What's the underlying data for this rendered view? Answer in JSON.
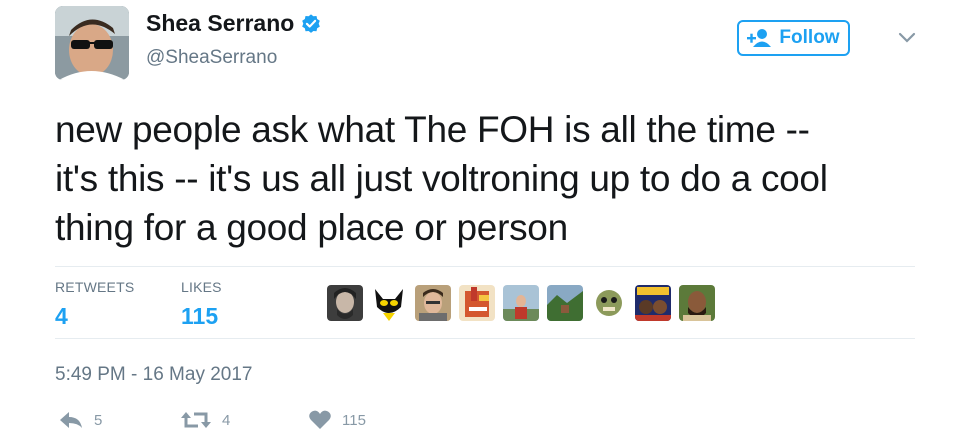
{
  "author": {
    "name": "Shea Serrano",
    "handle": "@SheaSerrano"
  },
  "follow_button": {
    "label": "Follow"
  },
  "tweet": {
    "lines": [
      "new people ask what The FOH is all the time --",
      "it's this -- it's us all just voltroning up to do a cool",
      "thing for a good place or person"
    ]
  },
  "stats": {
    "retweets_label": "RETWEETS",
    "retweets": "4",
    "likes_label": "LIKES",
    "likes": "115"
  },
  "liker_avatars": [
    {
      "bg": "#5b5b5b"
    },
    {
      "bg": "#ffffff"
    },
    {
      "bg": "#b8a37e"
    },
    {
      "bg": "#d46a3a"
    },
    {
      "bg": "#9fb7c9"
    },
    {
      "bg": "#4f7d3d"
    },
    {
      "bg": "#ffffff"
    },
    {
      "bg": "#2a3c8f"
    },
    {
      "bg": "#6b4f2e"
    }
  ],
  "timestamp": "5:49 PM - 16 May 2017",
  "actions": {
    "reply_count": "5",
    "retweet_count": "4",
    "like_count": "115"
  },
  "colors": {
    "accent": "#1da1f2",
    "muted": "#657786",
    "divider": "#e6ecf0"
  },
  "icons": [
    "verified-badge-icon",
    "follow-user-icon",
    "chevron-down-icon",
    "reply-icon",
    "retweet-icon",
    "heart-icon"
  ]
}
